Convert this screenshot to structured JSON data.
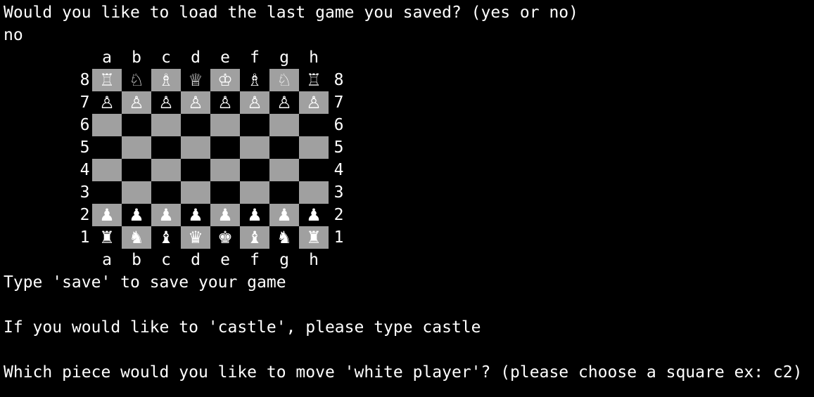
{
  "terminal": {
    "lines": [
      "Would you like to load the last game you saved? (yes or no)",
      "no"
    ],
    "after_board": [
      "Type 'save' to save your game",
      "",
      "If you would like to 'castle', please type castle",
      "",
      "Which piece would you like to move 'white player'? (please choose a square ex: c2)"
    ]
  },
  "board": {
    "files": [
      "a",
      "b",
      "c",
      "d",
      "e",
      "f",
      "g",
      "h"
    ],
    "ranks": [
      "8",
      "7",
      "6",
      "5",
      "4",
      "3",
      "2",
      "1"
    ],
    "rows": [
      [
        "♖",
        "♘",
        "♗",
        "♕",
        "♔",
        "♗",
        "♘",
        "♖"
      ],
      [
        "♙",
        "♙",
        "♙",
        "♙",
        "♙",
        "♙",
        "♙",
        "♙"
      ],
      [
        "",
        "",
        "",
        "",
        "",
        "",
        "",
        ""
      ],
      [
        "",
        "",
        "",
        "",
        "",
        "",
        "",
        ""
      ],
      [
        "",
        "",
        "",
        "",
        "",
        "",
        "",
        ""
      ],
      [
        "",
        "",
        "",
        "",
        "",
        "",
        "",
        ""
      ],
      [
        "♟",
        "♟",
        "♟",
        "♟",
        "♟",
        "♟",
        "♟",
        "♟"
      ],
      [
        "♜",
        "♞",
        "♝",
        "♛",
        "♚",
        "♝",
        "♞",
        "♜"
      ]
    ],
    "colors": {
      "light_square": "#a0a0a0",
      "dark_square": "#000000",
      "text": "#ffffff",
      "background": "#000000"
    }
  }
}
